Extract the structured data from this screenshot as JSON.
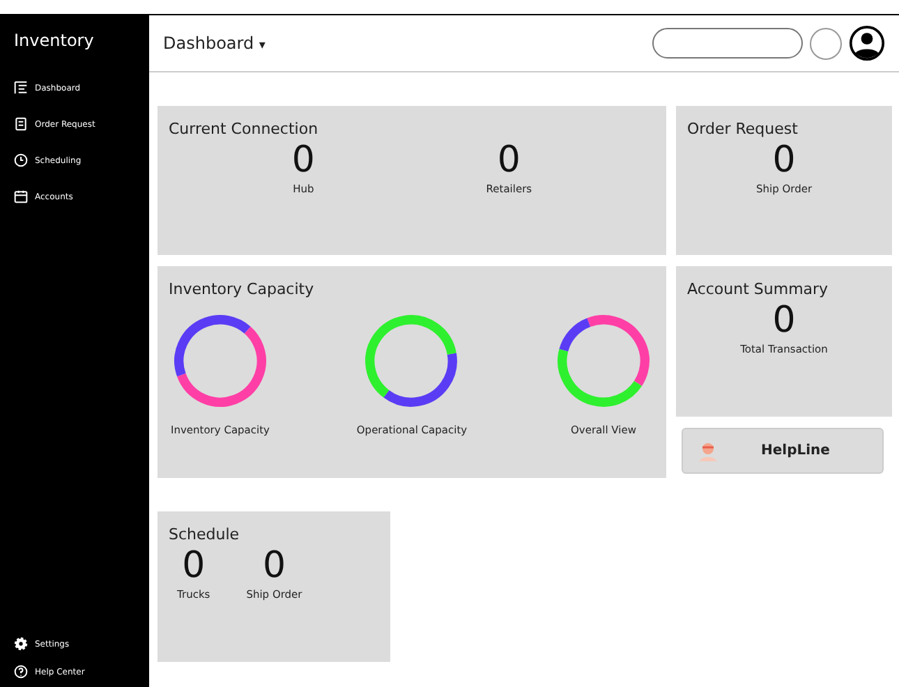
{
  "sidebar": {
    "title": "Inventory",
    "items": [
      {
        "label": "Dashboard"
      },
      {
        "label": "Order Request"
      },
      {
        "label": "Scheduling"
      },
      {
        "label": "Accounts"
      }
    ],
    "bottom_items": [
      {
        "label": "Settings"
      },
      {
        "label": "Help Center"
      }
    ]
  },
  "header": {
    "menu": "Dashboard",
    "caret": "▾"
  },
  "current_connection": {
    "title": "Current Connection",
    "stats": [
      {
        "value": "0",
        "label": "Hub"
      },
      {
        "value": "0",
        "label": "Retailers"
      }
    ]
  },
  "order_request": {
    "title": "Order Request",
    "value": "0",
    "label": "Ship Order"
  },
  "inventory_capacity": {
    "title": "Inventory Capacity",
    "rings": [
      {
        "label": "Inventory Capacity"
      },
      {
        "label": "Operational Capacity"
      },
      {
        "label": "Overall View"
      }
    ]
  },
  "account_summary": {
    "title": "Account Summary",
    "value": "0",
    "label": "Total Transaction"
  },
  "helpline": {
    "label": "HelpLine"
  },
  "schedule": {
    "title": "Schedule",
    "stats": [
      {
        "value": "0",
        "label": "Trucks"
      },
      {
        "value": "0",
        "label": "Ship Order"
      }
    ]
  }
}
